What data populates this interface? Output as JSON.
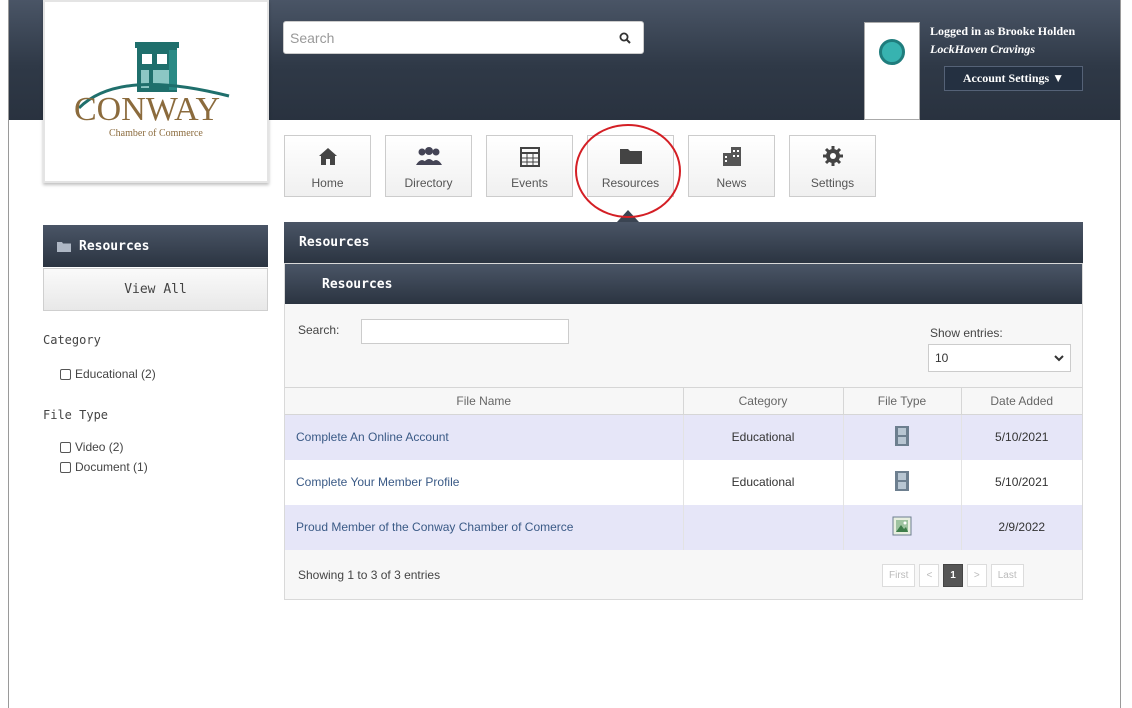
{
  "header": {
    "search_placeholder": "Search",
    "search_icon": "magnifier-icon",
    "user_line": "Logged in as Brooke Holden",
    "company": "LockHaven Cravings",
    "account_button": "Account Settings ▼"
  },
  "logo": {
    "wordmark": "CONWAY",
    "subtitle": "Chamber of Commerce"
  },
  "nav": {
    "items": [
      {
        "label": "Home",
        "icon": "house-icon"
      },
      {
        "label": "Directory",
        "icon": "people-icon"
      },
      {
        "label": "Events",
        "icon": "calendar-icon"
      },
      {
        "label": "Resources",
        "icon": "folder-icon"
      },
      {
        "label": "News",
        "icon": "building-icon"
      },
      {
        "label": "Settings",
        "icon": "gear-icon"
      }
    ],
    "active": "Resources"
  },
  "sidebar": {
    "header": "Resources",
    "view_all": "View All",
    "facets": [
      {
        "title": "Category",
        "options": [
          "Educational (2)"
        ]
      },
      {
        "title": "File Type",
        "options": [
          "Video (2)",
          "Document (1)"
        ]
      }
    ]
  },
  "main": {
    "title": "Resources",
    "panel_title": "Resources",
    "search_label": "Search:",
    "search_value": "",
    "show_entries_label": "Show entries:",
    "show_entries_value": "10",
    "columns": [
      "File Name",
      "Category",
      "File Type",
      "Date Added"
    ],
    "rows": [
      {
        "name": "Complete An Online Account",
        "category": "Educational",
        "type_icon": "film-icon",
        "date": "5/10/2021"
      },
      {
        "name": "Complete Your Member Profile",
        "category": "Educational",
        "type_icon": "film-icon",
        "date": "5/10/2021"
      },
      {
        "name": "Proud Member of the Conway Chamber of Comerce",
        "category": "",
        "type_icon": "image-icon",
        "date": "2/9/2022"
      }
    ],
    "showing": "Showing 1 to 3 of 3 entries",
    "pager": [
      "First",
      "<",
      "1",
      ">",
      "Last"
    ],
    "current_page": "1"
  },
  "colors": {
    "header_dark": "#2f3947",
    "link": "#3a5a86",
    "row_alt": "#e6e6f8",
    "highlight_ring": "#d41f25"
  }
}
